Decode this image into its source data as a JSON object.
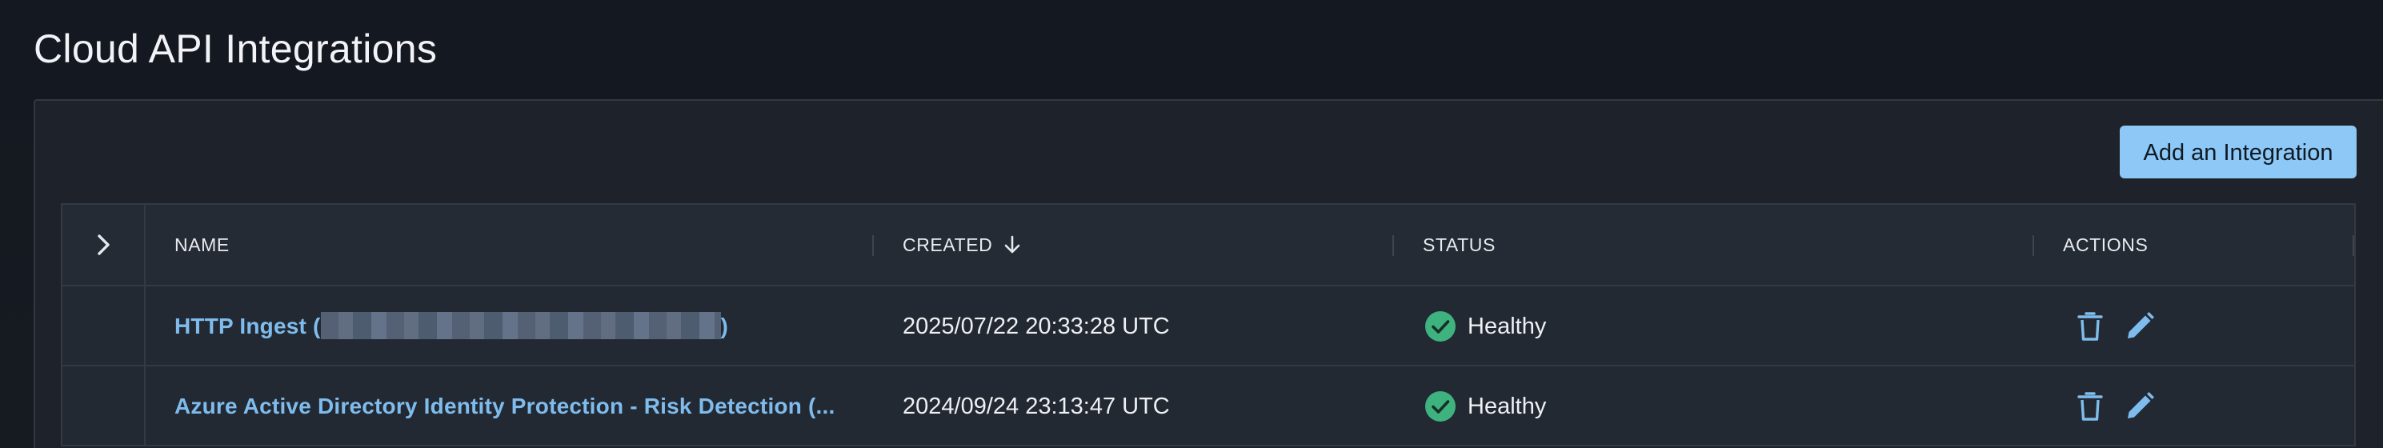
{
  "page": {
    "title": "Cloud API Integrations"
  },
  "toolbar": {
    "add_label": "Add an Integration"
  },
  "table": {
    "columns": {
      "name": "NAME",
      "created": "CREATED",
      "status": "STATUS",
      "actions": "ACTIONS"
    },
    "sort": {
      "column": "created",
      "direction": "descending",
      "icon": "arrow-down-icon"
    },
    "rows": [
      {
        "name_prefix": "HTTP Ingest (",
        "name_suffix": ")",
        "name_redacted": true,
        "created": "2025/07/22 20:33:28 UTC",
        "status": "Healthy"
      },
      {
        "name": "Azure Active Directory Identity Protection - Risk Detection (...",
        "created": "2024/09/24 23:13:47 UTC",
        "status": "Healthy"
      }
    ]
  },
  "colors": {
    "accent": "#8ec8f6",
    "link": "#7fbcee",
    "healthy": "#3fb37f",
    "action_icon": "#7fbcee"
  },
  "icons": {
    "expand": "chevron-right-icon",
    "healthy": "check-circle-icon",
    "delete": "trash-icon",
    "edit": "pencil-icon"
  }
}
